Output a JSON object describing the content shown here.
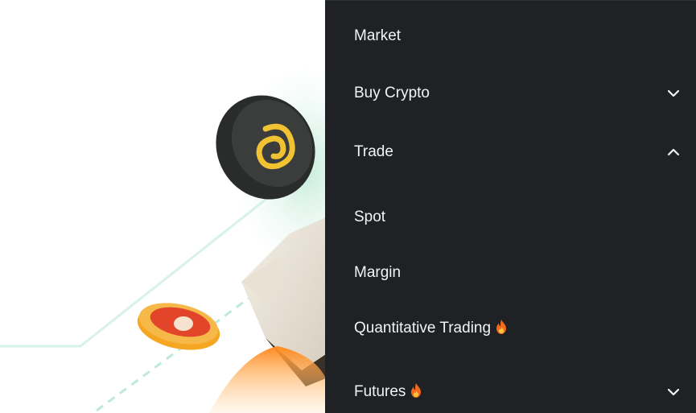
{
  "menu": {
    "items": [
      {
        "label": "Market",
        "chevron": "none",
        "hot": false
      },
      {
        "label": "Buy Crypto",
        "chevron": "down",
        "hot": false
      },
      {
        "label": "Trade",
        "chevron": "up",
        "hot": false
      },
      {
        "label": "Spot",
        "chevron": "none",
        "hot": false
      },
      {
        "label": "Margin",
        "chevron": "none",
        "hot": false
      },
      {
        "label": "Quantitative Trading",
        "chevron": "none",
        "hot": true
      },
      {
        "label": "Futures",
        "chevron": "down",
        "hot": true
      }
    ]
  },
  "icons": {
    "hot": "fire-icon",
    "expand": "chevron-down-icon",
    "collapse": "chevron-up-icon"
  },
  "colors": {
    "menu_bg": "#1f2125",
    "menu_text": "#f2f3f5",
    "accent_gold": "#f1c232",
    "coin_orange": "#f39a2e"
  }
}
